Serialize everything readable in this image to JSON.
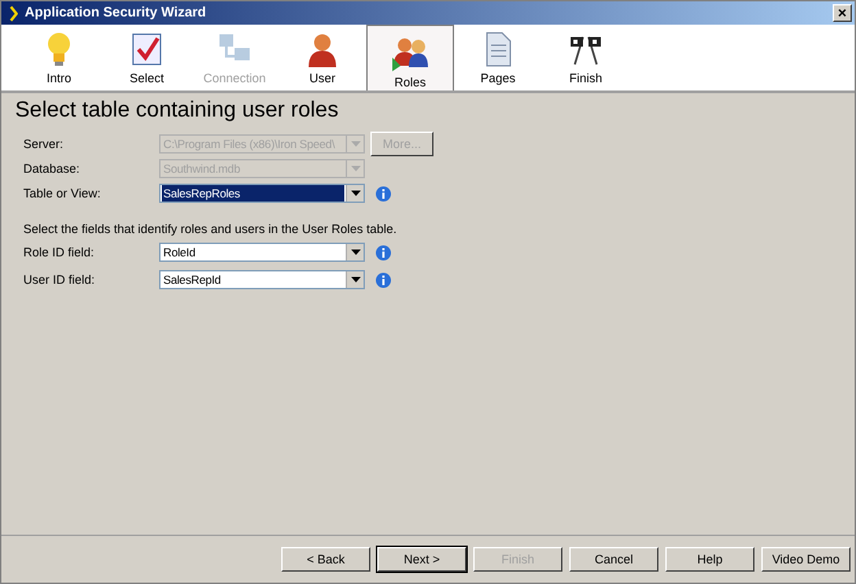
{
  "window": {
    "title": "Application Security Wizard",
    "close": "×"
  },
  "steps": [
    {
      "label": "Intro",
      "kind": "bulb",
      "selected": false,
      "disabled": false
    },
    {
      "label": "Select",
      "kind": "check",
      "selected": false,
      "disabled": false
    },
    {
      "label": "Connection",
      "kind": "network",
      "selected": false,
      "disabled": true
    },
    {
      "label": "User",
      "kind": "user",
      "selected": false,
      "disabled": false
    },
    {
      "label": "Roles",
      "kind": "roles",
      "selected": true,
      "disabled": false
    },
    {
      "label": "Pages",
      "kind": "pages",
      "selected": false,
      "disabled": false
    },
    {
      "label": "Finish",
      "kind": "flags",
      "selected": false,
      "disabled": false
    }
  ],
  "heading": "Select table containing user roles",
  "fields": [
    {
      "label": "Server:",
      "value": "C:\\Program Files (x86)\\Iron Speed\\",
      "disabled": true,
      "highlighted": false,
      "info": false,
      "button": "More..."
    },
    {
      "label": "Database:",
      "value": "Southwind.mdb",
      "disabled": true,
      "highlighted": false,
      "info": false
    },
    {
      "label": "Table or View:",
      "value": "SalesRepRoles",
      "disabled": false,
      "highlighted": true,
      "info": true
    }
  ],
  "instruction": "Select the fields that identify roles and users in the User Roles table.",
  "role_fields": [
    {
      "label": "Role ID field:",
      "value": "RoleId",
      "disabled": false,
      "highlighted": false,
      "info": true
    },
    {
      "label": "User ID field:",
      "value": "SalesRepId",
      "disabled": false,
      "highlighted": false,
      "info": true
    }
  ],
  "buttons": [
    {
      "label": "< Back",
      "disabled": false,
      "default": false
    },
    {
      "label": "Next >",
      "disabled": false,
      "default": true
    },
    {
      "label": "Finish",
      "disabled": true,
      "default": false
    },
    {
      "label": "Cancel",
      "disabled": false,
      "default": false
    },
    {
      "label": "Help",
      "disabled": false,
      "default": false
    },
    {
      "label": "Video Demo",
      "disabled": false,
      "default": false
    }
  ]
}
